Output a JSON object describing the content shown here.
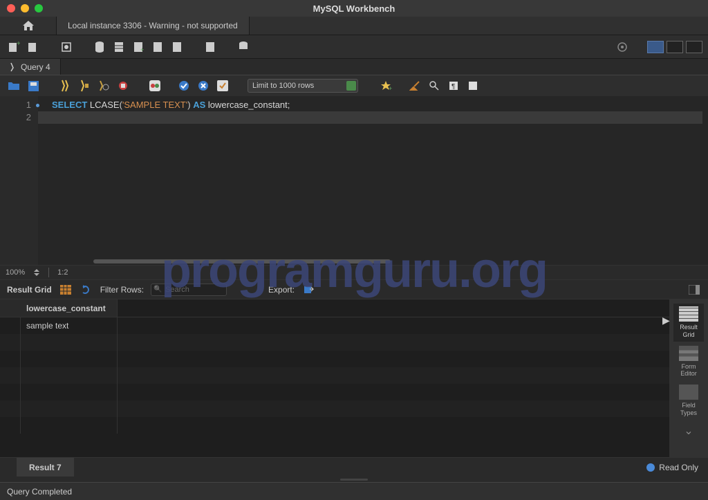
{
  "window": {
    "title": "MySQL Workbench"
  },
  "connTab": {
    "label": "Local instance 3306 - Warning - not supported"
  },
  "queryTab": {
    "label": "Query 4"
  },
  "queryToolbar": {
    "limit": "Limit to 1000 rows"
  },
  "code": {
    "line1": {
      "kw1": "SELECT",
      "fn": "LCASE",
      "p1": "(",
      "str": "'SAMPLE TEXT'",
      "p2": ")",
      "kw2": "AS",
      "ident": "lowercase_constant",
      "semi": ";"
    },
    "gutter": {
      "l1": "1",
      "l2": "2"
    }
  },
  "zoom": {
    "pct": "100%",
    "pos": "1:2"
  },
  "resultToolbar": {
    "label": "Result Grid",
    "filterLabel": "Filter Rows:",
    "searchPlaceholder": "Search",
    "exportLabel": "Export:"
  },
  "grid": {
    "header": {
      "col1": "lowercase_constant"
    },
    "rows": [
      {
        "col1": "sample text"
      }
    ]
  },
  "sidePanel": {
    "item1": {
      "l1": "Result",
      "l2": "Grid"
    },
    "item2": {
      "l1": "Form",
      "l2": "Editor"
    },
    "item3": {
      "l1": "Field",
      "l2": "Types"
    }
  },
  "resultTab": {
    "label": "Result 7"
  },
  "readOnly": {
    "label": "Read Only"
  },
  "status": {
    "text": "Query Completed"
  },
  "watermark": {
    "text": "programguru.org"
  }
}
